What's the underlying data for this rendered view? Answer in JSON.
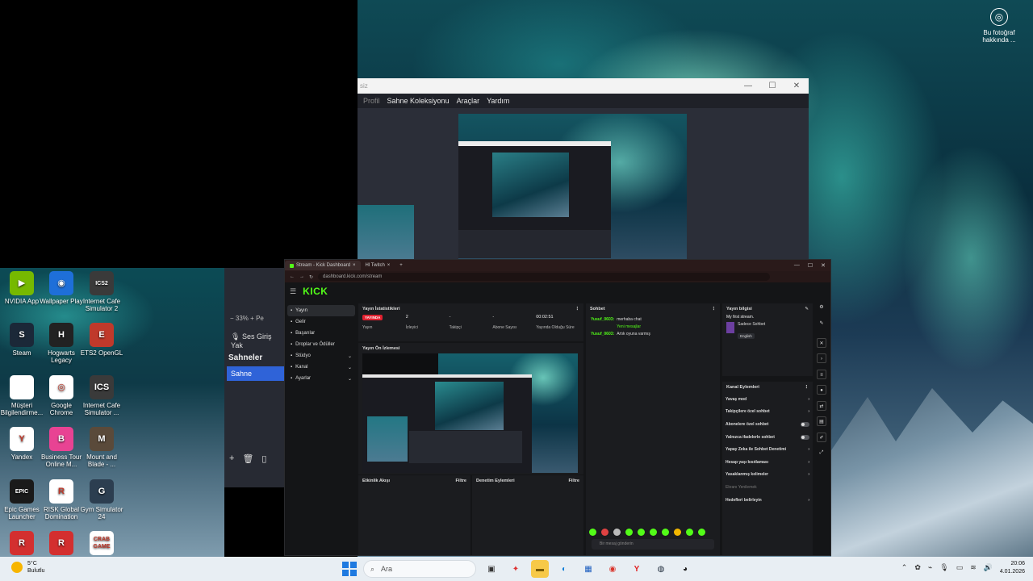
{
  "desktop": {
    "photo_info_label": "Bu fotoğraf hakkında ...",
    "icons": [
      {
        "label": "NVIDIA App",
        "color": "#76b900",
        "glyph": "▶"
      },
      {
        "label": "Wallpaper Play",
        "color": "#1e6fd9",
        "glyph": "◉"
      },
      {
        "label": "Internet Cafe Simulator 2",
        "color": "#3a3a3a",
        "glyph": "ICS2"
      },
      {
        "label": "Steam",
        "color": "#1b2838",
        "glyph": "S"
      },
      {
        "label": "Hogwarts Legacy",
        "color": "#222222",
        "glyph": "H"
      },
      {
        "label": "ETS2 OpenGL",
        "color": "#c0392b",
        "glyph": "E"
      },
      {
        "label": "Müşteri Bilgilendirme...",
        "color": "#ffffff",
        "glyph": ""
      },
      {
        "label": "Google Chrome",
        "color": "#ffffff",
        "glyph": "◎"
      },
      {
        "label": "Internet Cafe Simulator ...",
        "color": "#3a3a3a",
        "glyph": "ICS"
      },
      {
        "label": "Yandex",
        "color": "#ffffff",
        "glyph": "Y"
      },
      {
        "label": "Business Tour Online M...",
        "color": "#e84393",
        "glyph": "B"
      },
      {
        "label": "Mount and Blade - ...",
        "color": "#5a4a3a",
        "glyph": "M"
      },
      {
        "label": "Epic Games Launcher",
        "color": "#1a1a1a",
        "glyph": "EPIC"
      },
      {
        "label": "RISK Global Domination",
        "color": "#ffffff",
        "glyph": "R"
      },
      {
        "label": "Gym Simulator 24",
        "color": "#2c3e50",
        "glyph": "G"
      },
      {
        "label": "",
        "color": "#d32f2f",
        "glyph": "R"
      },
      {
        "label": "",
        "color": "#d32f2f",
        "glyph": "R"
      },
      {
        "label": "",
        "color": "#ffffff",
        "glyph": "CRAB GAME"
      }
    ]
  },
  "obs": {
    "title": "siz",
    "menu": [
      "Profil",
      "Sahne Koleksiyonu",
      "Araçlar",
      "Yardım"
    ],
    "zoom": "33%",
    "zoom_extra": "Pe",
    "mic_label": "Ses Giriş Yak",
    "scenes_header": "Sahneler",
    "scene_item": "Sahne"
  },
  "browser": {
    "tabs": [
      "Stream - Kick Dashboard",
      "Hl Twitch"
    ],
    "url": "dashboard.kick.com/stream"
  },
  "kick": {
    "logo": "KICK",
    "nav": [
      {
        "label": "Yayın",
        "chevron": ""
      },
      {
        "label": "Gelir",
        "chevron": ""
      },
      {
        "label": "Başarılar",
        "chevron": ""
      },
      {
        "label": "Droplar ve Ödüller",
        "chevron": ""
      },
      {
        "label": "Stüdyo",
        "chevron": "⌄"
      },
      {
        "label": "Kanal",
        "chevron": "⌄"
      },
      {
        "label": "Ayarlar",
        "chevron": "⌄"
      }
    ],
    "stats": {
      "header": "Yayın İstatistikleri",
      "live_badge": "YAYINDA",
      "items": [
        {
          "value": "",
          "label": "Yayın"
        },
        {
          "value": "2",
          "label": "İzleyici"
        },
        {
          "value": "-",
          "label": "Takipçi"
        },
        {
          "value": "-",
          "label": "Abone Sayısı"
        },
        {
          "value": "00:02:51",
          "label": "Yayında Olduğu Süre"
        }
      ]
    },
    "preview_header": "Yayın Ön İzlemesi",
    "activity": {
      "header": "Etkinlik Akışı",
      "filter": "Filtre"
    },
    "moderation": {
      "header": "Denetim Eylemleri",
      "filter": "Filtre"
    },
    "chat": {
      "header": "Sohbet",
      "messages": [
        {
          "user": "Yusuf_0603:",
          "text": "merhaba chat"
        },
        {
          "user": "Yusuf_0603:",
          "text": "Artık oyuna varmış"
        }
      ],
      "new_messages": "Yeni mesajlar",
      "input_placeholder": "Bir mesaj gönderin"
    },
    "stream_info": {
      "header": "Yayın bilgisi",
      "title": "My first stream.",
      "category": "Sadece Sohbet",
      "language": "English"
    },
    "channel_actions": {
      "header": "Kanal Eylemleri",
      "items": [
        {
          "label": "Yavaş mod",
          "control": "›",
          "dim": false
        },
        {
          "label": "Takipçilere özel sohbet",
          "control": "›",
          "dim": false
        },
        {
          "label": "Abonelere özel sohbet",
          "control": "toggle",
          "dim": false
        },
        {
          "label": "Yalnızca ifadelerle sohbet",
          "control": "toggle",
          "dim": false
        },
        {
          "label": "Yapay Zeka ile Sohbet Denetimi",
          "control": "›",
          "dim": false
        },
        {
          "label": "Hesap yaşı kısıtlaması",
          "control": "›",
          "dim": false
        },
        {
          "label": "Yasaklanmış kelimeler",
          "control": "›",
          "dim": false
        },
        {
          "label": "Ekranı Yenilemek",
          "control": "",
          "dim": true
        },
        {
          "label": "Hedefleri belirleyin",
          "control": "›",
          "dim": false
        }
      ]
    }
  },
  "taskbar": {
    "weather_temp": "5°C",
    "weather_cond": "Bulutlu",
    "search_placeholder": "Ara",
    "time": "20:06",
    "date": "4.01.2026"
  },
  "colors": {
    "kick_green": "#53fc18",
    "obs_blue": "#2f63d8",
    "live_red": "#e0202f"
  }
}
